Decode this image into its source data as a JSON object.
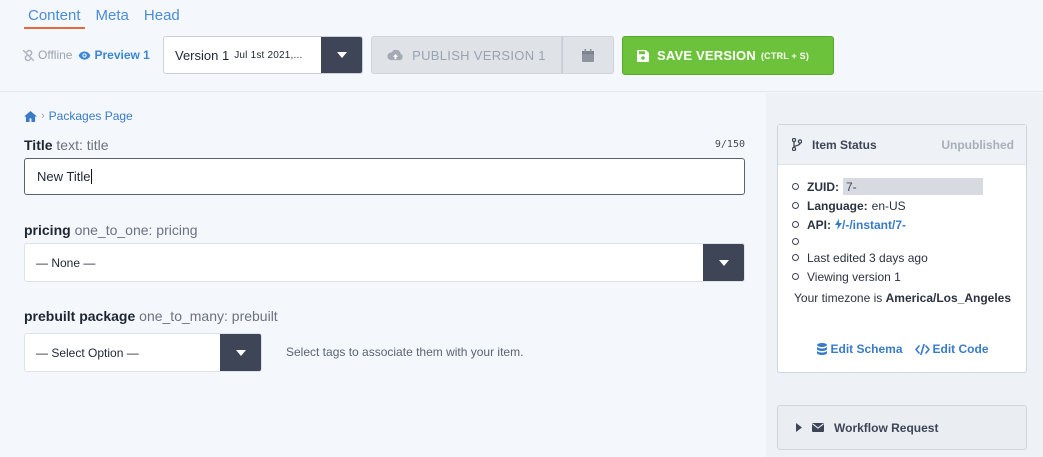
{
  "tabs": [
    {
      "label": "Content"
    },
    {
      "label": "Meta"
    },
    {
      "label": "Head"
    }
  ],
  "toolbar": {
    "offline_label": "Offline",
    "preview_label": "Preview 1",
    "version_label": "Version 1",
    "version_date": "Jul 1st 2021,...",
    "publish_label": "PUBLISH VERSION 1",
    "save_label": "SAVE VERSION",
    "save_shortcut": "(CTRL + S)"
  },
  "breadcrumb": {
    "page": "Packages Page"
  },
  "fields": {
    "title": {
      "name": "Title",
      "type": "text: title",
      "counter": "9/150",
      "value": "New Title"
    },
    "pricing": {
      "name": "pricing",
      "type": "one_to_one: pricing",
      "value": "— None —"
    },
    "prebuilt": {
      "name": "prebuilt package",
      "type": "one_to_many: prebuilt",
      "value": "— Select Option —",
      "hint": "Select tags to associate them with your item."
    }
  },
  "status": {
    "title": "Item Status",
    "badge": "Unpublished",
    "zuid_label": "ZUID:",
    "zuid_value": "7-",
    "language_label": "Language:",
    "language_value": "en-US",
    "api_label": "API:",
    "api_value": "/-/instant/7-",
    "last_edited": "Last edited 3 days ago",
    "viewing": "Viewing version 1",
    "timezone_prefix": "Your timezone is",
    "timezone": "America/Los_Angeles",
    "edit_schema": "Edit Schema",
    "edit_code": "Edit Code"
  },
  "workflow": {
    "label": "Workflow Request"
  },
  "colors": {
    "accent": "#3a7bc8",
    "save_green": "#6cc23a",
    "tab_underline": "#e26a3b",
    "dark_button": "#3e4556"
  }
}
